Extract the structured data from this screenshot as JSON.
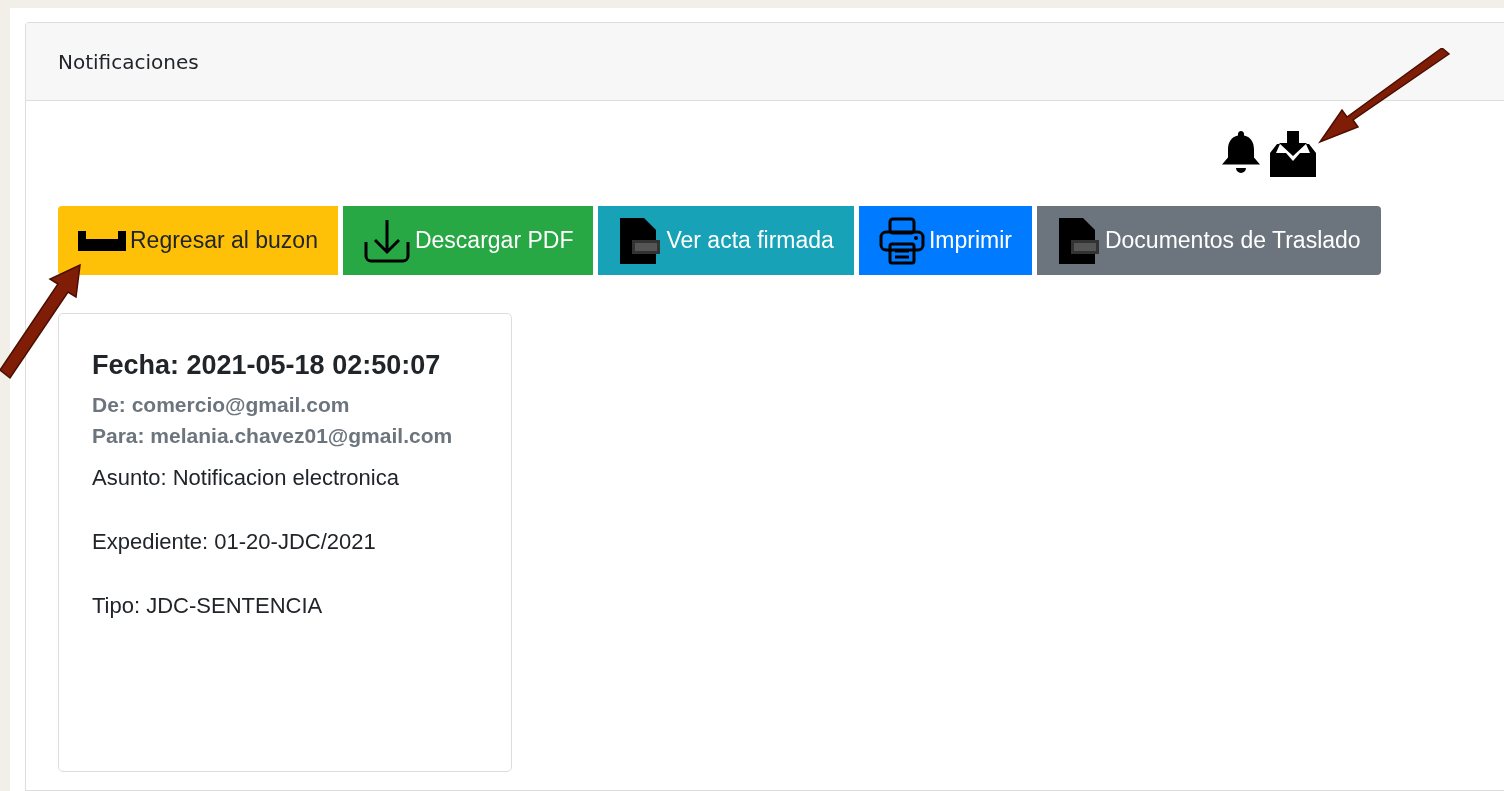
{
  "panel": {
    "title": "Notificaciones"
  },
  "buttons": [
    {
      "label": "Regresar al buzon"
    },
    {
      "label": "Descargar PDF"
    },
    {
      "label": "Ver acta firmada"
    },
    {
      "label": "Imprimir"
    },
    {
      "label": "Documentos de Traslado"
    }
  ],
  "notification": {
    "date": "Fecha: 2021-05-18 02:50:07",
    "from": "De: comercio@gmail.com",
    "to": "Para: melania.chavez01@gmail.com",
    "subject": "Asunto: Notificacion electronica",
    "file": "Expediente: 01-20-JDC/2021",
    "type": "Tipo: JDC-SENTENCIA"
  }
}
